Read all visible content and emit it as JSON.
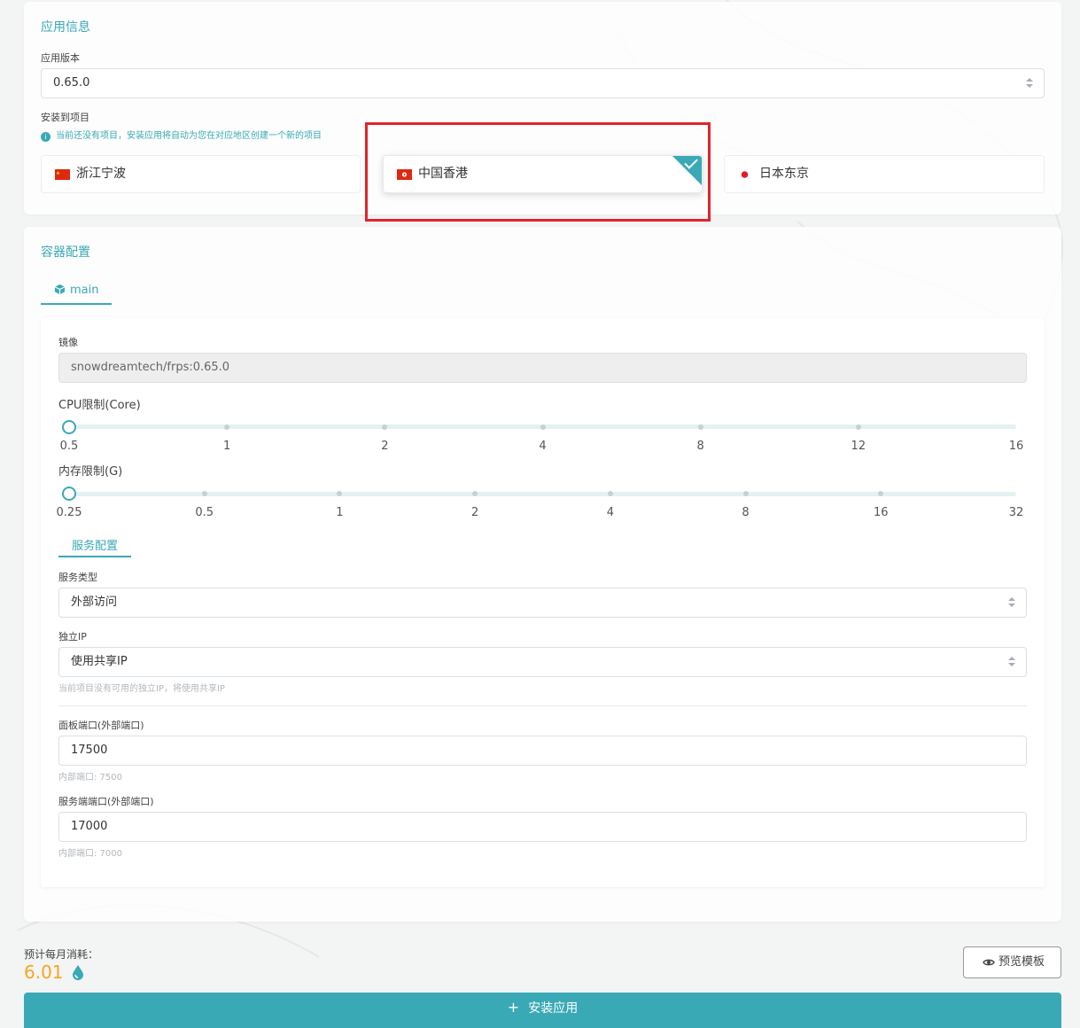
{
  "app_info": {
    "title": "应用信息",
    "version_label": "应用版本",
    "version_value": "0.65.0",
    "project_label": "安装到项目",
    "project_notice": "当前还没有项目，安装应用将自动为您在对应地区创建一个新的项目",
    "regions": [
      {
        "label": "浙江宁波",
        "flag": "china-flag-icon",
        "selected": false
      },
      {
        "label": "中国香港",
        "flag": "hong-kong-flag-icon",
        "selected": true
      },
      {
        "label": "日本东京",
        "flag": "japan-flag-icon",
        "selected": false
      }
    ]
  },
  "container": {
    "title": "容器配置",
    "tab_label": "main",
    "image_label": "镜像",
    "image_value": "snowdreamtech/frps:0.65.0",
    "cpu": {
      "label": "CPU限制(Core)",
      "ticks": [
        "0.5",
        "1",
        "2",
        "4",
        "8",
        "12",
        "16"
      ],
      "selected": "0.5"
    },
    "memory": {
      "label": "内存限制(G)",
      "ticks": [
        "0.25",
        "0.5",
        "1",
        "2",
        "4",
        "8",
        "16",
        "32"
      ],
      "selected": "0.25"
    },
    "service_tab": "服务配置",
    "service_type_label": "服务类型",
    "service_type_value": "外部访问",
    "ip_label": "独立IP",
    "ip_value": "使用共享IP",
    "ip_hint": "当前项目没有可用的独立IP，将使用共享IP",
    "panel_port_label": "面板端口(外部端口)",
    "panel_port_value": "17500",
    "panel_port_hint": "内部端口: 7500",
    "server_port_label": "服务端端口(外部端口)",
    "server_port_value": "17000",
    "server_port_hint": "内部端口: 7000"
  },
  "footer": {
    "cost_label": "预计每月消耗：",
    "cost_value": "6.01",
    "preview_label": "预览模板",
    "install_label": "安装应用"
  },
  "colors": {
    "accent": "#3aa9b6",
    "cost": "#f5a623",
    "highlight": "#e0242b"
  }
}
